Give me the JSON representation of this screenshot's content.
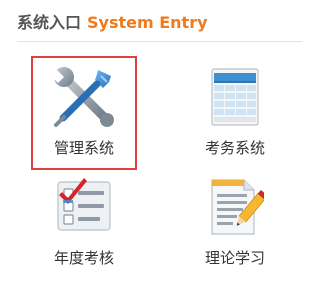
{
  "header": {
    "title_cn": "系统入口",
    "title_en": "System Entry"
  },
  "tiles": [
    {
      "label": "管理系统",
      "icon": "tools-wrench-screwdriver-icon",
      "selected": true
    },
    {
      "label": "考务系统",
      "icon": "spreadsheet-table-icon",
      "selected": false
    },
    {
      "label": "年度考核",
      "icon": "checklist-icon",
      "selected": false
    },
    {
      "label": "理论学习",
      "icon": "document-pencil-icon",
      "selected": false
    }
  ],
  "colors": {
    "accent": "#f07a1c",
    "selection_border": "#e0413b",
    "tool_blue": "#3d8fd6",
    "tool_grey": "#8e9aa6"
  }
}
